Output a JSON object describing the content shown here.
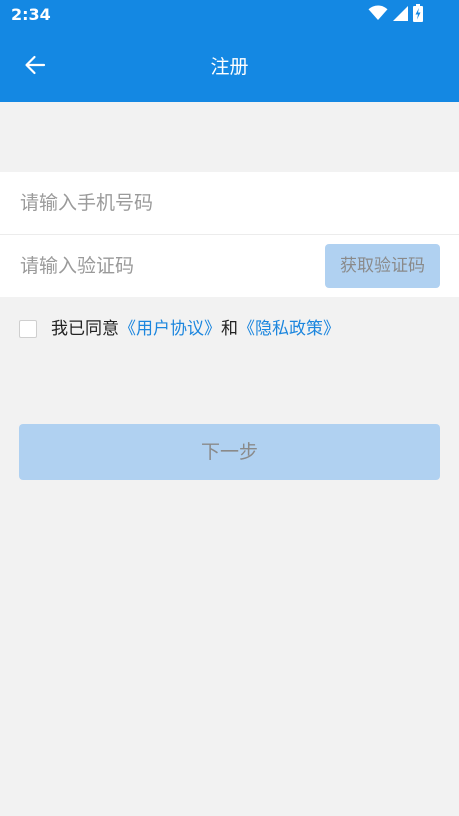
{
  "status_bar": {
    "time": "2:34",
    "icons": [
      "wifi-icon",
      "signal-icon",
      "battery-charging-icon"
    ]
  },
  "app_bar": {
    "back_icon": "arrow-left-icon",
    "title": "注册"
  },
  "form": {
    "phone": {
      "value": "",
      "placeholder": "请输入手机号码"
    },
    "code": {
      "value": "",
      "placeholder": "请输入验证码"
    },
    "get_code_label": "获取验证码"
  },
  "agreement": {
    "checked": false,
    "prefix": "我已同意",
    "user_agreement": "《用户协议》",
    "connector": "和",
    "privacy_policy": "《隐私政策》"
  },
  "next_label": "下一步",
  "colors": {
    "primary": "#1488e3",
    "link": "#1c86de",
    "disabled_button": "#b0d1f1",
    "background": "#f2f2f2"
  }
}
